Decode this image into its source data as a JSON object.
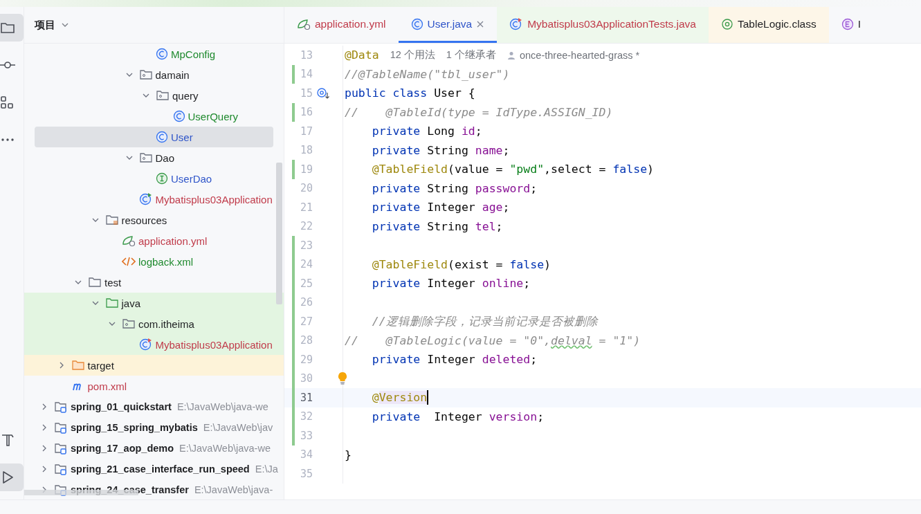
{
  "tool_strip": {
    "top": [
      {
        "kind": "project",
        "selected": true
      },
      {
        "kind": "commit",
        "selected": false
      },
      {
        "kind": "structure",
        "selected": false
      },
      {
        "kind": "more",
        "selected": false
      }
    ],
    "bottom": [
      {
        "kind": "build",
        "selected": false
      },
      {
        "kind": "run",
        "selected": true
      }
    ]
  },
  "project_panel": {
    "title": "项目",
    "tree": [
      {
        "children": [
          {
            "children": [
              {
                "children": [
                  {
                    "children": [
                      {
                        "children": [
                          {
                            "children": [
                              {
                                "label": "MpConfig",
                                "kind": "class",
                                "color": "#1f8a2e",
                                "selected": false
                              }
                            ]
                          },
                          {
                            "label": "damain",
                            "kind": "package",
                            "expanded": true,
                            "selected": false,
                            "children": [
                              {
                                "label": "query",
                                "kind": "package",
                                "expanded": true,
                                "selected": false,
                                "children": [
                                  {
                                    "label": "UserQuery",
                                    "kind": "class",
                                    "color": "#1f8a2e",
                                    "selected": false
                                  }
                                ]
                              },
                              {
                                "label": "User",
                                "kind": "class",
                                "color": "#2f55c9",
                                "selected": true
                              }
                            ]
                          },
                          {
                            "label": "Dao",
                            "kind": "package",
                            "expanded": true,
                            "selected": false,
                            "children": [
                              {
                                "label": "UserDao",
                                "kind": "interface",
                                "color": "#2f55c9",
                                "selected": false
                              }
                            ]
                          },
                          {
                            "label": "Mybatisplus03Application",
                            "kind": "spring-app",
                            "color": "#c03b4a",
                            "selected": false
                          }
                        ]
                      }
                    ]
                  },
                  {
                    "label": "resources",
                    "kind": "resources",
                    "expanded": true,
                    "selected": false,
                    "children": [
                      {
                        "label": "application.yml",
                        "kind": "yml",
                        "color": "#c03b4a",
                        "selected": false
                      },
                      {
                        "label": "logback.xml",
                        "kind": "xml",
                        "color": "#1f8a2e",
                        "selected": false
                      }
                    ]
                  }
                ]
              },
              {
                "label": "test",
                "kind": "folder",
                "expanded": true,
                "selected": false,
                "children": [
                  {
                    "label": "java",
                    "kind": "test-root",
                    "expanded": true,
                    "selected": false,
                    "children": [
                      {
                        "label": "com.itheima",
                        "kind": "package",
                        "expanded": true,
                        "selected": false,
                        "children": [
                          {
                            "label": "Mybatisplus03Application",
                            "kind": "test-class",
                            "color": "#c03b4a",
                            "selected": false
                          }
                        ]
                      }
                    ]
                  }
                ]
              }
            ]
          },
          {
            "label": "target",
            "kind": "excluded",
            "expanded": false,
            "selected": false
          },
          {
            "label": "pom.xml",
            "kind": "maven",
            "color": "#c03b4a",
            "selected": false
          }
        ]
      },
      {
        "label": "spring_01_quickstart",
        "path": "E:\\JavaWeb\\java-we",
        "kind": "module",
        "expanded": false,
        "selected": false
      },
      {
        "label": "spring_15_spring_mybatis",
        "path": "E:\\JavaWeb\\jav",
        "kind": "module",
        "expanded": false,
        "selected": false
      },
      {
        "label": "spring_17_aop_demo",
        "path": "E:\\JavaWeb\\java-we",
        "kind": "module",
        "expanded": false,
        "selected": false
      },
      {
        "label": "spring_21_case_interface_run_speed",
        "path": "E:\\Ja",
        "kind": "module",
        "expanded": false,
        "selected": false
      },
      {
        "label": "spring_24_case_transfer",
        "path": "E:\\JavaWeb\\java-",
        "kind": "module",
        "expanded": false,
        "selected": false
      }
    ]
  },
  "tabs": [
    {
      "label": "application.yml",
      "kind": "yml",
      "color": "#c03b4a",
      "selected": false
    },
    {
      "label": "User.java",
      "kind": "class",
      "color": "#2f55c9",
      "selected": true
    },
    {
      "label": "Mybatisplus03ApplicationTests.java",
      "kind": "test-class",
      "color": "#c03b4a",
      "selected": false
    },
    {
      "label": "TableLogic.class",
      "kind": "annotation",
      "selected": false
    },
    {
      "label": "I",
      "kind": "enum",
      "selected": false
    }
  ],
  "editor": {
    "lines": [
      {
        "number": "13",
        "changed": false,
        "tokens": [
          {
            "kind": "ann",
            "text": "@Data"
          }
        ],
        "hints": [
          "12 个用法",
          "1 个继承者"
        ],
        "author": "once-three-hearted-grass *"
      },
      {
        "number": "14",
        "changed": true,
        "tokens": [
          {
            "kind": "cmt",
            "text": "//@TableName(\"tbl_user\")"
          }
        ]
      },
      {
        "number": "15",
        "changed": false,
        "inherited": true,
        "tokens": [
          {
            "kind": "kw",
            "text": "public class "
          },
          {
            "kind": "plain",
            "text": "User {"
          }
        ]
      },
      {
        "number": "16",
        "changed": true,
        "tokens": [
          {
            "kind": "cmt",
            "text": "//    @TableId(type = IdType.ASSIGN_ID)"
          }
        ]
      },
      {
        "number": "17",
        "changed": false,
        "tokens": [
          {
            "kind": "kw",
            "text": "    private "
          },
          {
            "kind": "plain",
            "text": "Long "
          },
          {
            "kind": "field",
            "text": "id"
          },
          {
            "kind": "plain",
            "text": ";"
          }
        ]
      },
      {
        "number": "18",
        "changed": false,
        "tokens": [
          {
            "kind": "kw",
            "text": "    private "
          },
          {
            "kind": "plain",
            "text": "String "
          },
          {
            "kind": "field",
            "text": "name"
          },
          {
            "kind": "plain",
            "text": ";"
          }
        ]
      },
      {
        "number": "19",
        "changed": true,
        "tokens": [
          {
            "kind": "ann",
            "text": "    @TableField"
          },
          {
            "kind": "plain",
            "text": "(value = "
          },
          {
            "kind": "str",
            "text": "\"pwd\""
          },
          {
            "kind": "plain",
            "text": ",select = "
          },
          {
            "kind": "kw",
            "text": "false"
          },
          {
            "kind": "plain",
            "text": ")"
          }
        ]
      },
      {
        "number": "20",
        "changed": false,
        "tokens": [
          {
            "kind": "kw",
            "text": "    private "
          },
          {
            "kind": "plain",
            "text": "String "
          },
          {
            "kind": "field",
            "text": "password"
          },
          {
            "kind": "plain",
            "text": ";"
          }
        ]
      },
      {
        "number": "21",
        "changed": false,
        "tokens": [
          {
            "kind": "kw",
            "text": "    private "
          },
          {
            "kind": "plain",
            "text": "Integer "
          },
          {
            "kind": "field",
            "text": "age"
          },
          {
            "kind": "plain",
            "text": ";"
          }
        ]
      },
      {
        "number": "22",
        "changed": false,
        "tokens": [
          {
            "kind": "kw",
            "text": "    private "
          },
          {
            "kind": "plain",
            "text": "String "
          },
          {
            "kind": "field",
            "text": "tel"
          },
          {
            "kind": "plain",
            "text": ";"
          }
        ]
      },
      {
        "number": "23",
        "changed": true
      },
      {
        "number": "24",
        "changed": true,
        "tokens": [
          {
            "kind": "ann",
            "text": "    @TableField"
          },
          {
            "kind": "plain",
            "text": "(exist = "
          },
          {
            "kind": "kw",
            "text": "false"
          },
          {
            "kind": "plain",
            "text": ")"
          }
        ]
      },
      {
        "number": "25",
        "changed": true,
        "tokens": [
          {
            "kind": "kw",
            "text": "    private "
          },
          {
            "kind": "plain",
            "text": "Integer "
          },
          {
            "kind": "field",
            "text": "online"
          },
          {
            "kind": "plain",
            "text": ";"
          }
        ]
      },
      {
        "number": "26",
        "changed": true
      },
      {
        "number": "27",
        "changed": true,
        "tokens": [
          {
            "kind": "cmt",
            "text": "    //逻辑删除字段，记录当前记录是否被删除"
          }
        ]
      },
      {
        "number": "28",
        "changed": true,
        "tokens": [
          {
            "kind": "cmt",
            "text": "//    @TableLogic(value = \"0\","
          },
          {
            "kind": "cmt",
            "text": "delval",
            "typo": true
          },
          {
            "kind": "cmt",
            "text": " = \"1\")"
          }
        ]
      },
      {
        "number": "29",
        "changed": true,
        "tokens": [
          {
            "kind": "kw",
            "text": "    private "
          },
          {
            "kind": "plain",
            "text": "Integer "
          },
          {
            "kind": "field",
            "text": "deleted"
          },
          {
            "kind": "plain",
            "text": ";"
          }
        ]
      },
      {
        "number": "30",
        "changed": true,
        "bulb": true
      },
      {
        "number": "31",
        "changed": true,
        "current": true,
        "caret": true,
        "tokens": [
          {
            "kind": "ann",
            "text": "    @"
          },
          {
            "kind": "ann",
            "text": "Version",
            "highlighted": true
          }
        ]
      },
      {
        "number": "32",
        "changed": true,
        "tokens": [
          {
            "kind": "kw",
            "text": "    private  "
          },
          {
            "kind": "plain",
            "text": "Integer "
          },
          {
            "kind": "field",
            "text": "version"
          },
          {
            "kind": "plain",
            "text": ";"
          }
        ]
      },
      {
        "number": "33",
        "changed": true
      },
      {
        "number": "34",
        "changed": false,
        "tokens": [
          {
            "kind": "plain",
            "text": "}"
          }
        ]
      },
      {
        "number": "35",
        "changed": false
      }
    ]
  }
}
